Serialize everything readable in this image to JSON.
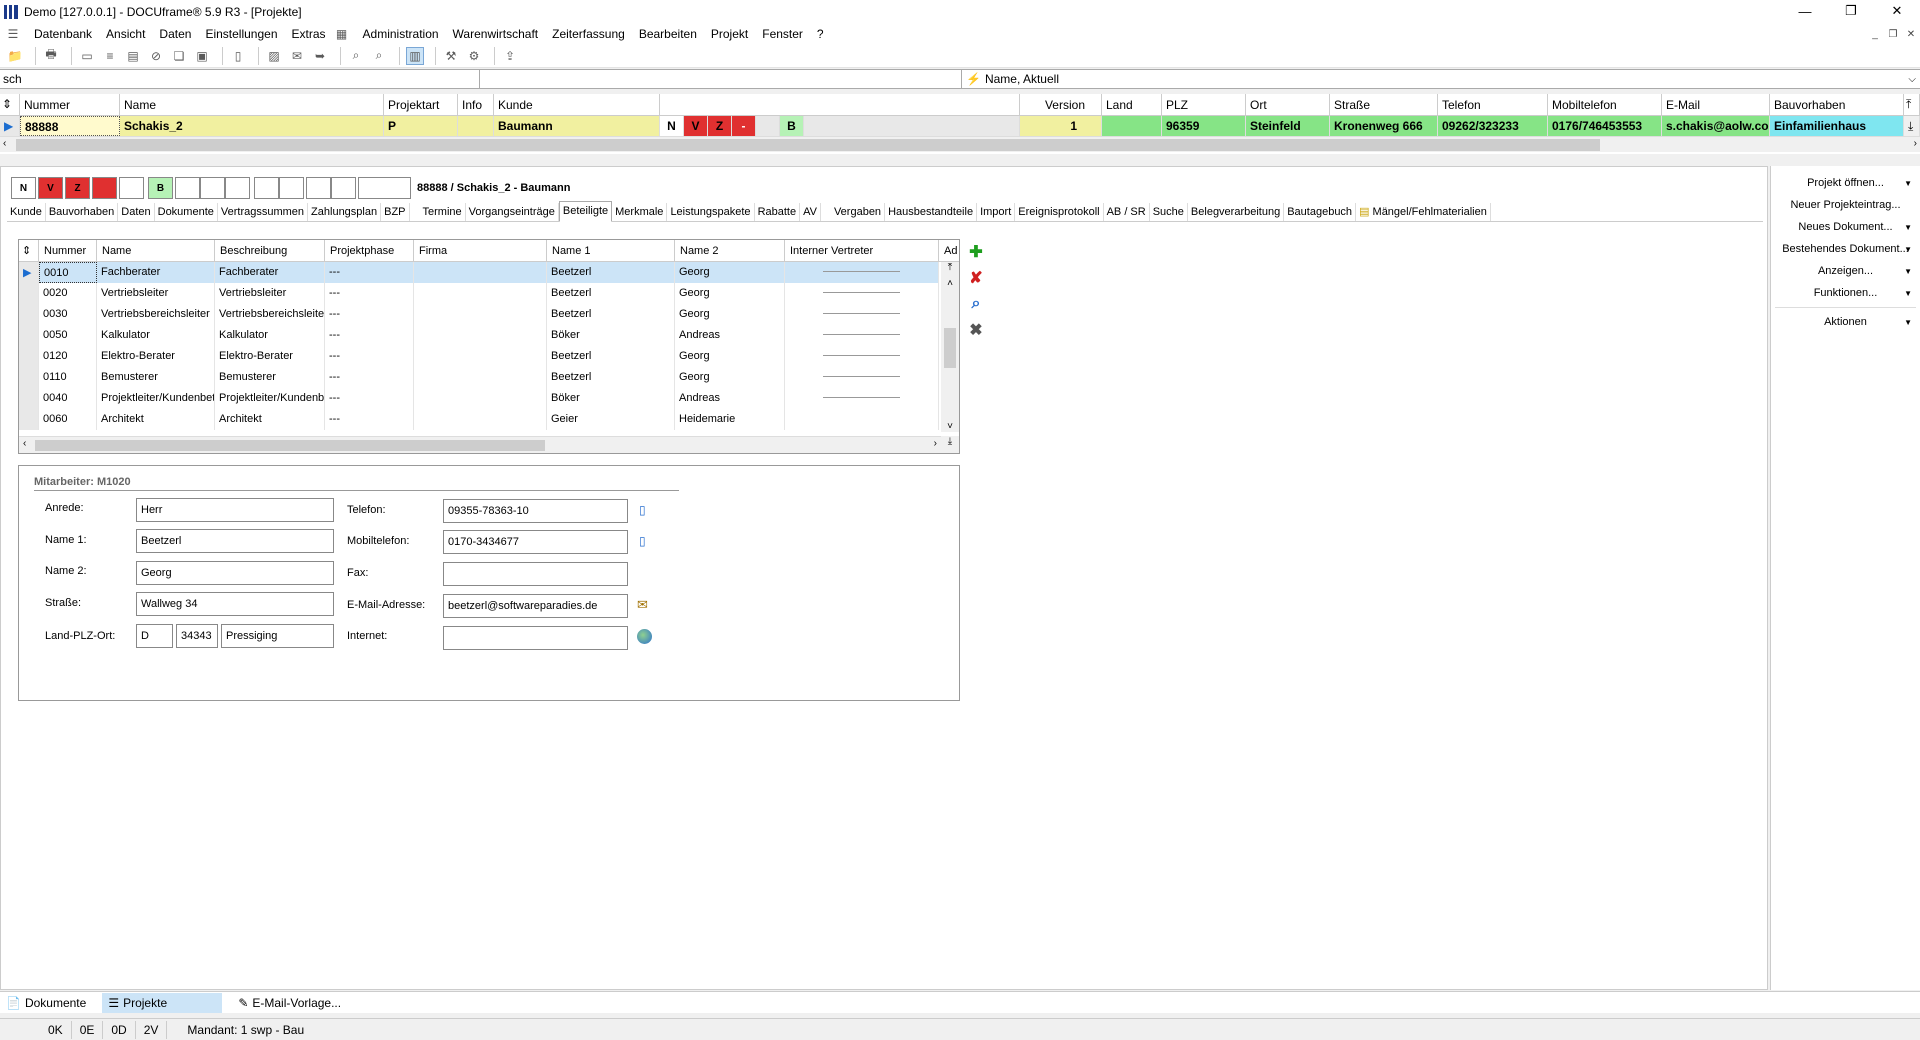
{
  "window": {
    "title": "Demo [127.0.0.1] - DOCUframe® 5.9 R3 - [Projekte]"
  },
  "menu": [
    "Datenbank",
    "Ansicht",
    "Daten",
    "Einstellungen",
    "Extras",
    "Administration",
    "Warenwirtschaft",
    "Zeiterfassung",
    "Bearbeiten",
    "Projekt",
    "Fenster",
    "?"
  ],
  "search": {
    "value": "sch",
    "sort": "Name, Aktuell"
  },
  "project_grid": {
    "headers": [
      "Nummer",
      "Name",
      "Projektart",
      "Info",
      "Kunde",
      "Version",
      "Land",
      "PLZ",
      "Ort",
      "Straße",
      "Telefon",
      "Mobiltelefon",
      "E-Mail",
      "Bauvorhaben"
    ],
    "row": {
      "nummer": "88888",
      "name": "Schakis_2",
      "projektart": "P",
      "kunde": "Baumann",
      "flags": [
        "N",
        "V",
        "Z",
        "-",
        "B"
      ],
      "version": "1",
      "plz": "96359",
      "ort": "Steinfeld",
      "strasse": "Kronenweg 666",
      "telefon": "09262/323233",
      "mobil": "0176/746453553",
      "email": "s.chakis@aolw.cor",
      "bauvorhaben": "Einfamilienhaus"
    }
  },
  "status_boxes": [
    "N",
    "V",
    "Z",
    "",
    "",
    "B"
  ],
  "project_label": "88888 / Schakis_2 - Baumann",
  "tabs": [
    "Kunde",
    "Bauvorhaben",
    "Daten",
    "Dokumente",
    "Vertragssummen",
    "Zahlungsplan",
    "BZP",
    "Termine",
    "Vorgangseinträge",
    "Beteiligte",
    "Merkmale",
    "Leistungspakete",
    "Rabatte",
    "AV",
    "Vergaben",
    "Hausbestandteile",
    "Import",
    "Ereignisprotokoll",
    "AB / SR",
    "Suche",
    "Belegverarbeitung",
    "Bautagebuch",
    "Mängel/Fehlmaterialien"
  ],
  "active_tab": "Beteiligte",
  "beteiligte": {
    "headers": [
      "Nummer",
      "Name",
      "Beschreibung",
      "Projektphase",
      "Firma",
      "Name 1",
      "Name 2",
      "Interner Vertreter",
      "Ad"
    ],
    "rows": [
      [
        "0010",
        "Fachberater",
        "Fachberater",
        "---",
        "",
        "Beetzerl",
        "Georg"
      ],
      [
        "0020",
        "Vertriebsleiter",
        "Vertriebsleiter",
        "---",
        "",
        "Beetzerl",
        "Georg"
      ],
      [
        "0030",
        "Vertriebsbereichsleiter",
        "Vertriebsbereichsleite",
        "---",
        "",
        "Beetzerl",
        "Georg"
      ],
      [
        "0050",
        "Kalkulator",
        "Kalkulator",
        "---",
        "",
        "Böker",
        "Andreas"
      ],
      [
        "0120",
        "Elektro-Berater",
        "Elektro-Berater",
        "---",
        "",
        "Beetzerl",
        "Georg"
      ],
      [
        "0110",
        "Bemusterer",
        "Bemusterer",
        "---",
        "",
        "Beetzerl",
        "Georg"
      ],
      [
        "0040",
        "Projektleiter/Kundenbet",
        "Projektleiter/Kundenb",
        "---",
        "",
        "Böker",
        "Andreas"
      ],
      [
        "0060",
        "Architekt",
        "Architekt",
        "---",
        "",
        "Geier",
        "Heidemarie"
      ]
    ]
  },
  "detail": {
    "heading": "Mitarbeiter: M1020",
    "labels": {
      "anrede": "Anrede:",
      "name1": "Name 1:",
      "name2": "Name 2:",
      "strasse": "Straße:",
      "lpo": "Land-PLZ-Ort:",
      "telefon": "Telefon:",
      "mobil": "Mobiltelefon:",
      "fax": "Fax:",
      "email": "E-Mail-Adresse:",
      "internet": "Internet:"
    },
    "values": {
      "anrede": "Herr",
      "name1": "Beetzerl",
      "name2": "Georg",
      "strasse": "Wallweg 34",
      "land": "D",
      "plz": "34343",
      "ort": "Pressiging",
      "telefon": "09355-78363-10",
      "mobil": "0170-3434677",
      "fax": "",
      "email": "beetzerl@softwareparadies.de",
      "internet": ""
    }
  },
  "right_panel": [
    "Projekt öffnen...",
    "Neuer Projekteintrag...",
    "Neues Dokument...",
    "Bestehendes Dokument...",
    "Anzeigen...",
    "Funktionen...",
    "Aktionen"
  ],
  "bottom_tabs": [
    "Dokumente",
    "Projekte",
    "E-Mail-Vorlage..."
  ],
  "statusbar": [
    "0K",
    "0E",
    "0D",
    "2V",
    "Mandant: 1 swp - Bau"
  ]
}
